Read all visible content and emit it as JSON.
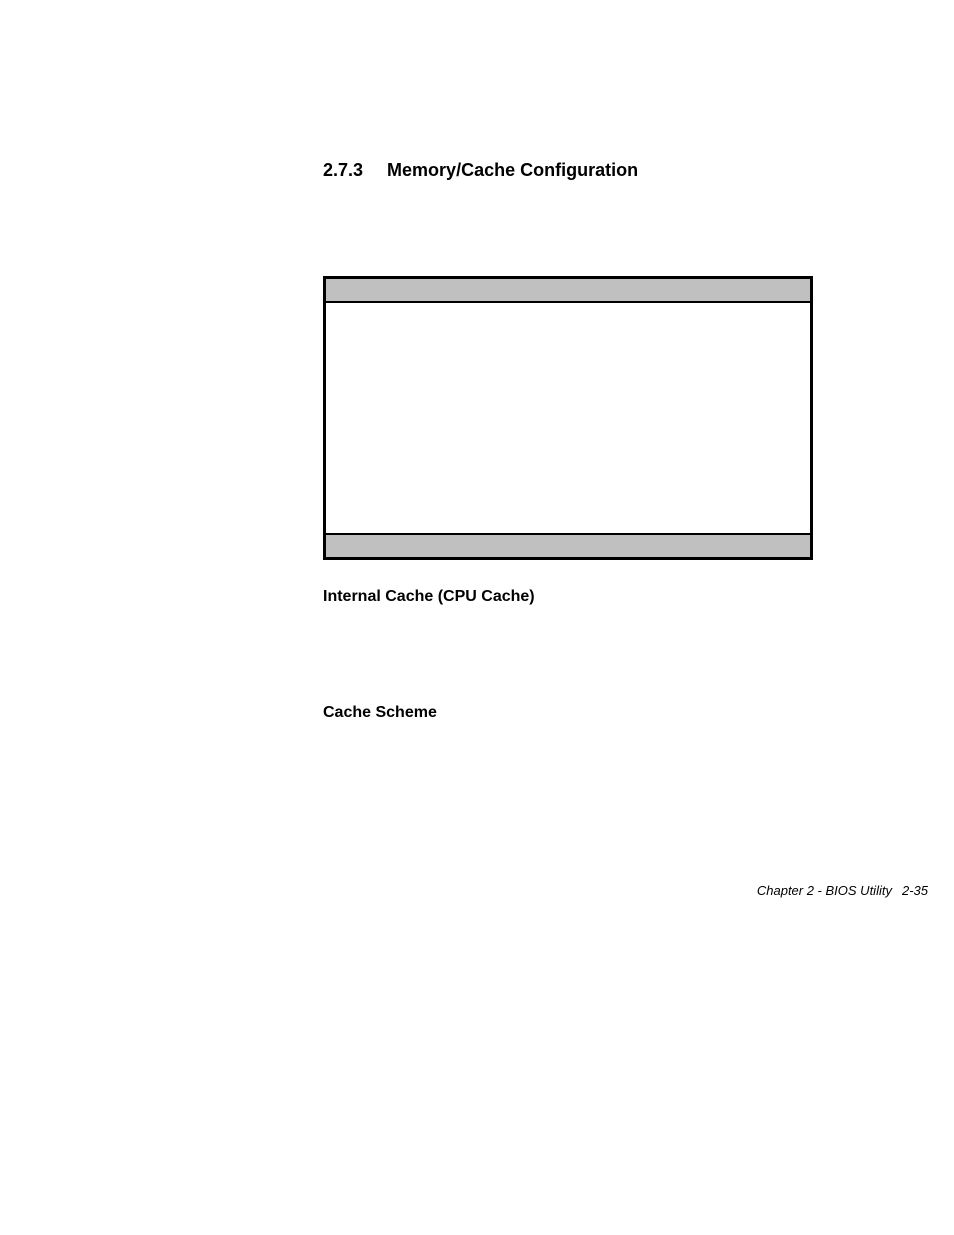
{
  "section": {
    "number": "2.7.3",
    "title": "Memory/Cache Configuration"
  },
  "subsections": {
    "internal_cache": "Internal Cache (CPU Cache)",
    "cache_scheme": "Cache Scheme"
  },
  "footer": {
    "chapter_label": "Chapter 2 - BIOS Utility",
    "page_number": "2-35"
  }
}
